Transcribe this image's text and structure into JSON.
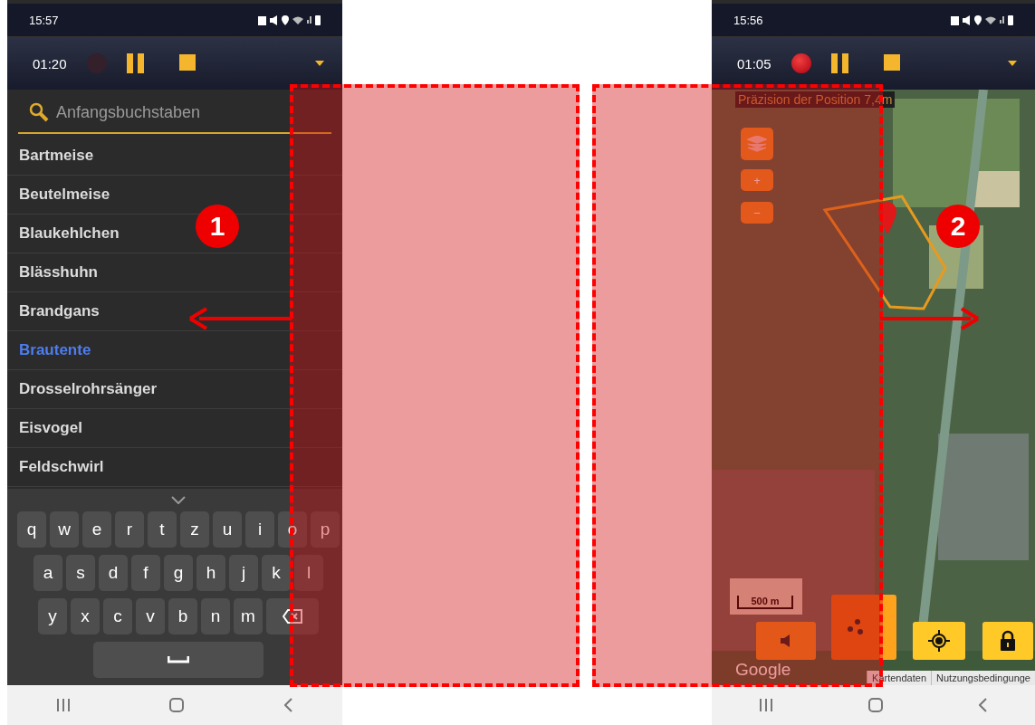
{
  "left_screen": {
    "status_bar": {
      "time": "15:57"
    },
    "recorder": {
      "elapsed": "01:20",
      "recording": false
    },
    "search": {
      "placeholder": "Anfangsbuchstaben"
    },
    "species": [
      {
        "name": "Bartmeise",
        "selected": false
      },
      {
        "name": "Beutelmeise",
        "selected": false
      },
      {
        "name": "Blaukehlchen",
        "selected": false
      },
      {
        "name": "Blässhuhn",
        "selected": false
      },
      {
        "name": "Brandgans",
        "selected": false
      },
      {
        "name": "Brautente",
        "selected": true
      },
      {
        "name": "Drosselrohrsänger",
        "selected": false
      },
      {
        "name": "Eisvogel",
        "selected": false
      },
      {
        "name": "Feldschwirl",
        "selected": false
      }
    ],
    "keyboard": {
      "rows": [
        [
          "q",
          "w",
          "e",
          "r",
          "t",
          "z",
          "u",
          "i",
          "o",
          "p"
        ],
        [
          "a",
          "s",
          "d",
          "f",
          "g",
          "h",
          "j",
          "k",
          "l"
        ],
        [
          "y",
          "x",
          "c",
          "v",
          "b",
          "n",
          "m"
        ]
      ]
    }
  },
  "right_screen": {
    "status_bar": {
      "time": "15:56"
    },
    "recorder": {
      "elapsed": "01:05",
      "recording": true
    },
    "map": {
      "accuracy": "Präzision der Position 7,4m",
      "zoom_in": "+",
      "zoom_out": "−",
      "scale": "500 m",
      "attribution": "Google",
      "links": [
        "Kartendaten",
        "Nutzungsbedingunge"
      ]
    }
  },
  "callouts": [
    {
      "number": "1"
    },
    {
      "number": "2"
    }
  ]
}
